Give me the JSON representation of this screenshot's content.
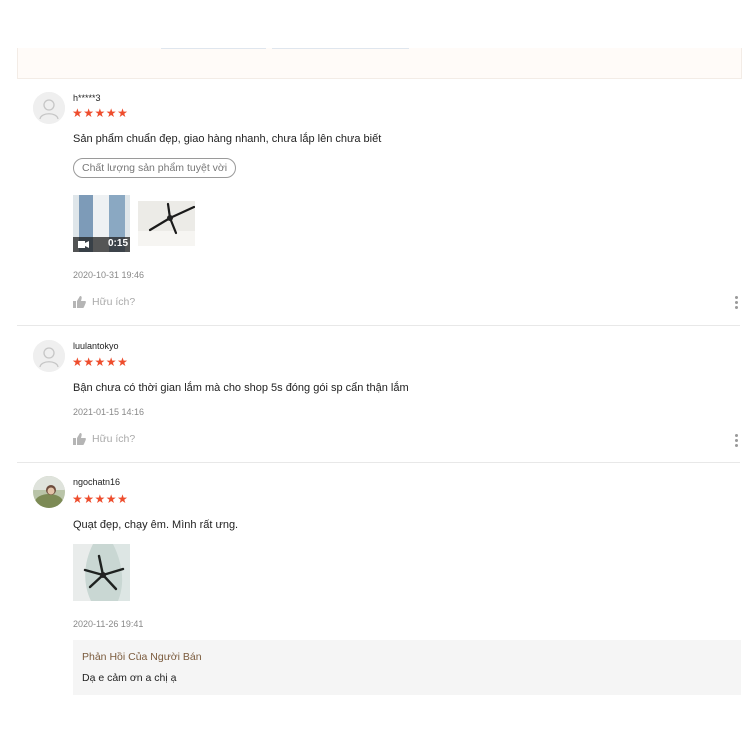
{
  "reviews": [
    {
      "author": "h*****3",
      "rating": 5,
      "content": "Sản phẩm chuẩn đẹp, giao hàng nhanh, chưa lắp lên chưa biết",
      "tag": "Chất lượng sản phẩm tuyệt vời",
      "video_duration": "0:15",
      "date": "2020-10-31 19:46",
      "helpful_label": "Hữu ích?"
    },
    {
      "author": "luulantokyo",
      "rating": 5,
      "content": "Bận chưa có thời gian lắm mà cho shop 5s đóng gói sp cẩn thận lắm",
      "date": "2021-01-15 14:16",
      "helpful_label": "Hữu ích?"
    },
    {
      "author": "ngochatn16",
      "rating": 5,
      "content": "Quạt đẹp, chạy êm. Mình rất ưng.",
      "date": "2020-11-26 19:41",
      "seller_reply": {
        "title": "Phản Hồi Của Người Bán",
        "text": "Dạ e cảm ơn a chị ạ"
      }
    }
  ],
  "icons": {
    "star": "star-icon",
    "thumb": "thumbs-up-icon",
    "more": "more-vertical-icon",
    "video": "video-camera-icon"
  },
  "colors": {
    "star": "#ee4d2d",
    "seller_title": "#7a5a3c",
    "muted": "#888888"
  }
}
